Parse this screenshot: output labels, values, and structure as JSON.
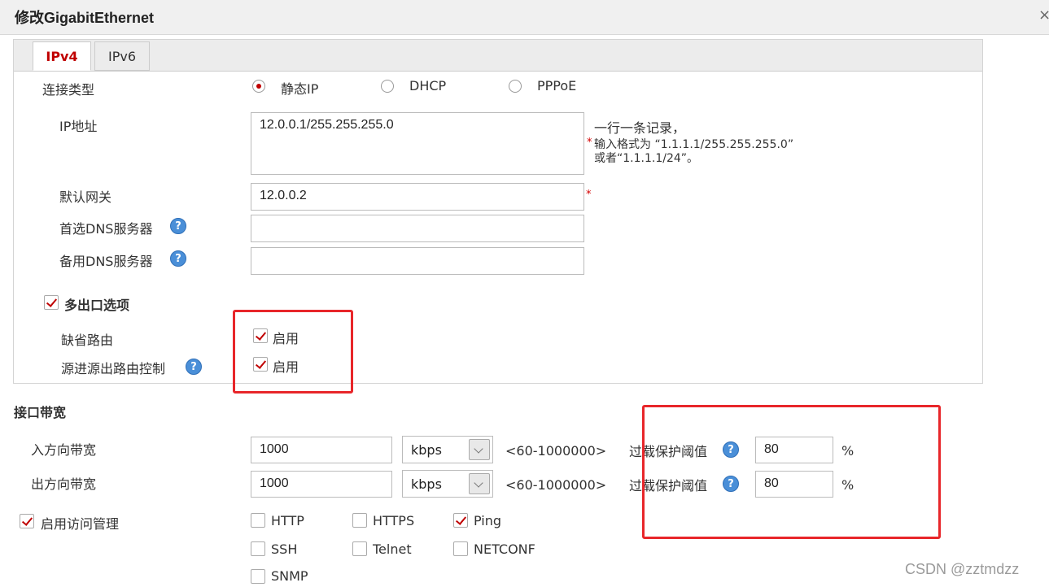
{
  "window": {
    "title": "修改GigabitEthernet",
    "close": "×"
  },
  "tabs": [
    {
      "label": "IPv4",
      "active": true
    },
    {
      "label": "IPv6",
      "active": false
    }
  ],
  "conn_type": {
    "label": "连接类型",
    "options": [
      {
        "label": "静态IP",
        "selected": true
      },
      {
        "label": "DHCP",
        "selected": false
      },
      {
        "label": "PPPoE",
        "selected": false
      }
    ]
  },
  "ip": {
    "label": "IP地址",
    "value": "12.0.0.1/255.255.255.0",
    "hint_line1": "一行一条记录，",
    "hint_line2": "输入格式为 “1.1.1.1/255.255.255.0”",
    "hint_line3": "或者“1.1.1.1/24”。",
    "required": "*"
  },
  "gateway": {
    "label": "默认网关",
    "value": "12.0.0.2",
    "required": "*"
  },
  "dns1": {
    "label": "首选DNS服务器",
    "help": "?",
    "value": ""
  },
  "dns2": {
    "label": "备用DNS服务器",
    "help": "?",
    "value": ""
  },
  "multi_exit": {
    "label": "多出口选项",
    "checked": true
  },
  "default_route": {
    "label": "缺省路由",
    "option": "启用",
    "checked": true
  },
  "src_route": {
    "label": "源进源出路由控制",
    "help": "?",
    "option": "启用",
    "checked": true
  },
  "bandwidth": {
    "section": "接口带宽",
    "rows": [
      {
        "label": "入方向带宽",
        "value": "1000",
        "unit": "kbps",
        "range": "<60-1000000>",
        "overload_label": "过载保护阈值",
        "overload_value": "80",
        "percent": "%"
      },
      {
        "label": "出方向带宽",
        "value": "1000",
        "unit": "kbps",
        "range": "<60-1000000>",
        "overload_label": "过载保护阈值",
        "overload_value": "80",
        "percent": "%"
      }
    ]
  },
  "access": {
    "label": "启用访问管理",
    "checked": true,
    "services": [
      {
        "label": "HTTP",
        "checked": false
      },
      {
        "label": "HTTPS",
        "checked": false
      },
      {
        "label": "Ping",
        "checked": true
      },
      {
        "label": "SSH",
        "checked": false
      },
      {
        "label": "Telnet",
        "checked": false
      },
      {
        "label": "NETCONF",
        "checked": false
      },
      {
        "label": "SNMP",
        "checked": false
      }
    ]
  },
  "watermark": "CSDN @zztmdzz",
  "colors": {
    "accent": "#c00000",
    "highlight_box": "#e8262a",
    "help_icon": "#4a8fd8"
  }
}
